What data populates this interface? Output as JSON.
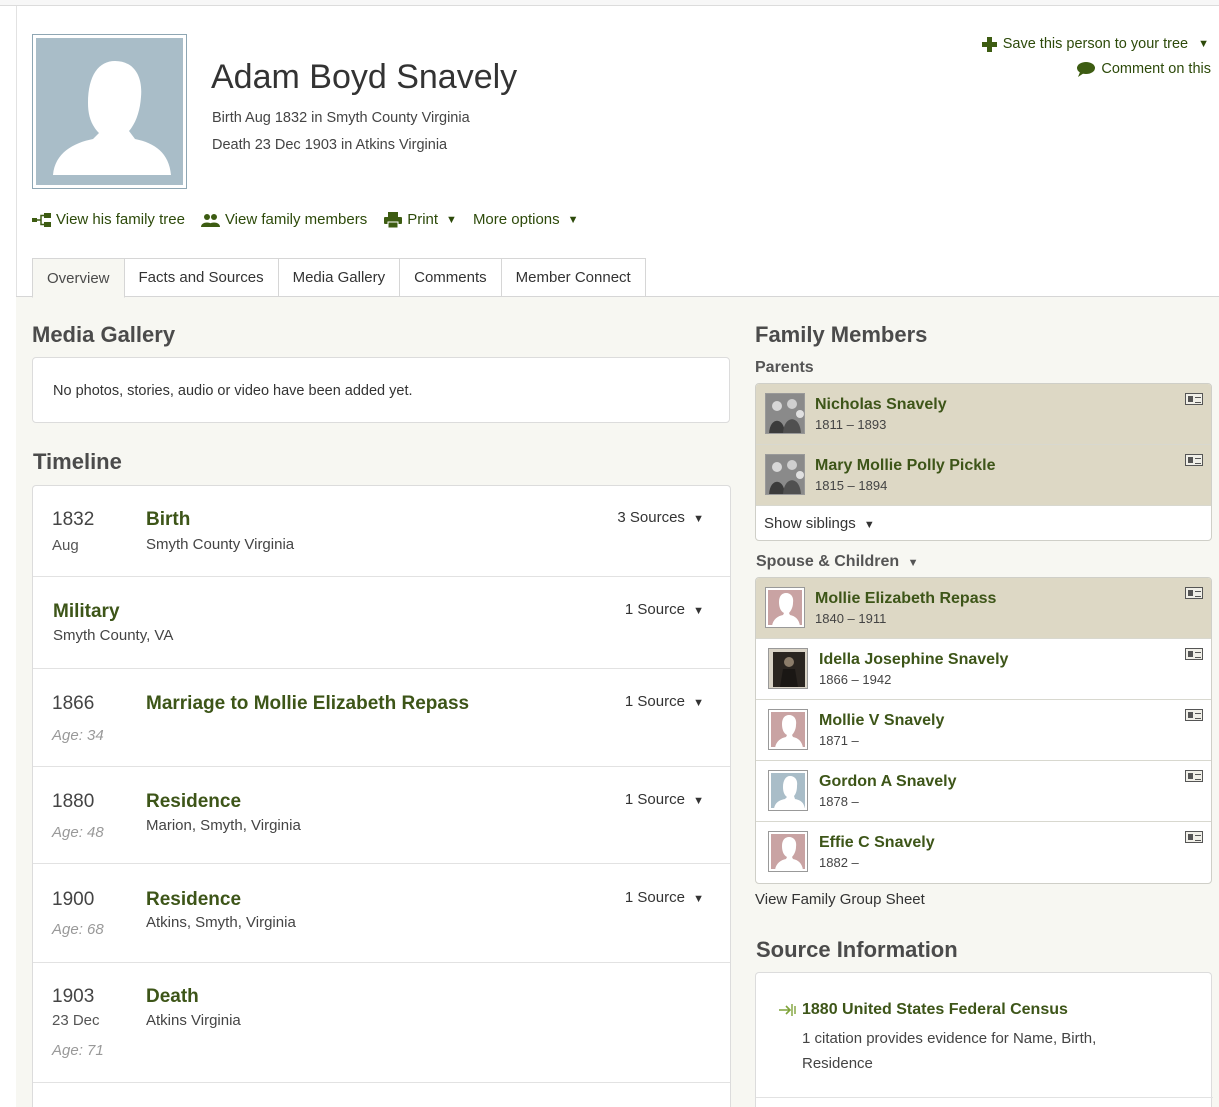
{
  "person": {
    "name": "Adam Boyd Snavely",
    "birth": "Birth Aug 1832 in Smyth County Virginia",
    "death": "Death 23 Dec 1903 in Atkins Virginia"
  },
  "header_links": {
    "save": "Save this person to your tree",
    "comment": "Comment on this"
  },
  "actions": [
    {
      "label": "View his family tree",
      "icon": "family-tree-icon"
    },
    {
      "label": "View family members",
      "icon": "family-members-icon"
    },
    {
      "label": "Print",
      "icon": "print-icon"
    },
    {
      "label": "More options"
    }
  ],
  "tabs": [
    "Overview",
    "Facts and Sources",
    "Media Gallery",
    "Comments",
    "Member Connect"
  ],
  "media_gallery": {
    "heading": "Media Gallery",
    "empty": "No photos, stories, audio or video have been added yet."
  },
  "timeline": {
    "heading": "Timeline",
    "events": [
      {
        "year": "1832",
        "sub": "Aug",
        "title": "Birth",
        "place": "Smyth County Virginia",
        "sources": "3 Sources",
        "age": ""
      },
      {
        "year": "",
        "sub": "",
        "title": "Military",
        "place": "Smyth County, VA",
        "sources": "1 Source",
        "age": ""
      },
      {
        "year": "1866",
        "sub": "",
        "title": "Marriage to Mollie Elizabeth Repass",
        "place": "",
        "sources": "1 Source",
        "age": "Age: 34"
      },
      {
        "year": "1880",
        "sub": "",
        "title": "Residence",
        "place": "Marion, Smyth, Virginia",
        "sources": "1 Source",
        "age": "Age: 48"
      },
      {
        "year": "1900",
        "sub": "",
        "title": "Residence",
        "place": "Atkins, Smyth, Virginia",
        "sources": "1 Source",
        "age": "Age: 68"
      },
      {
        "year": "1903",
        "sub": "23 Dec",
        "title": "Death",
        "place": "Atkins Virginia",
        "sources": "",
        "age": "Age: 71"
      }
    ]
  },
  "family": {
    "heading": "Family Members",
    "parents_label": "Parents",
    "parents": [
      {
        "name": "Nicholas Snavely",
        "dates": "1811 – 1893"
      },
      {
        "name": "Mary Mollie Polly Pickle",
        "dates": "1815 – 1894"
      }
    ],
    "show_siblings": "Show siblings",
    "spouse_label": "Spouse & Children",
    "spouse": {
      "name": "Mollie Elizabeth Repass",
      "dates": "1840 – 1911"
    },
    "children": [
      {
        "name": "Idella Josephine Snavely",
        "dates": "1866 – 1942"
      },
      {
        "name": "Mollie V Snavely",
        "dates": "1871 –"
      },
      {
        "name": "Gordon A Snavely",
        "dates": "1878 –"
      },
      {
        "name": "Effie C Snavely",
        "dates": "1882 –"
      }
    ],
    "group_sheet": "View Family Group Sheet"
  },
  "source_info": {
    "heading": "Source Information",
    "title": "1880 United States Federal Census",
    "desc": "1 citation provides evidence for Name, Birth, Residence"
  },
  "colors": {
    "link_green": "#3d5518",
    "highlight_row": "#ddd8c5",
    "male_silhouette_bg": "#a9bdc8",
    "female_silhouette_bg": "#c9a3a3"
  }
}
